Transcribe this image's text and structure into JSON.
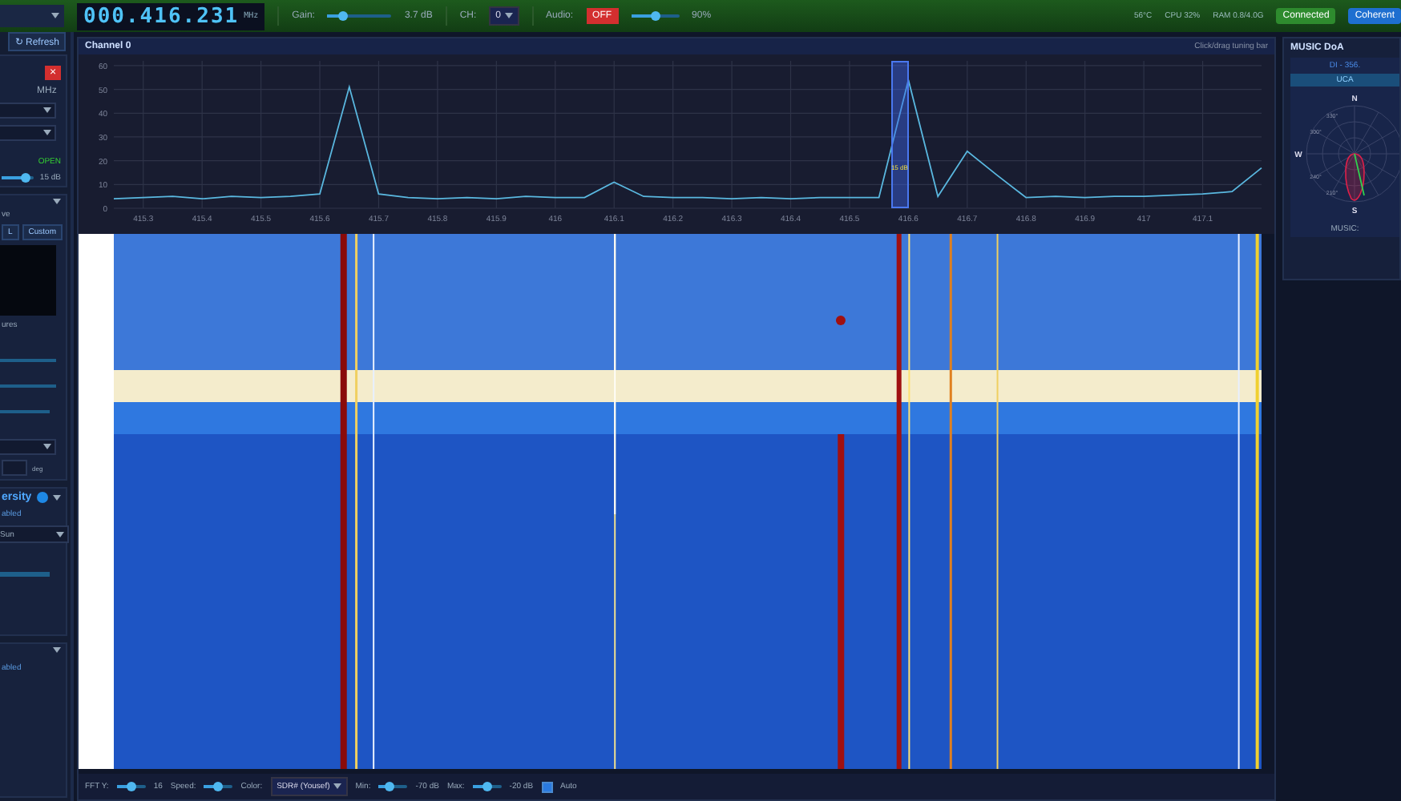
{
  "top_bar": {
    "freq": "000.416.231",
    "freq_unit": "MHz",
    "gain": {
      "label": "Gain:",
      "level": 0.25,
      "reading": "3.7 dB"
    },
    "channel": {
      "label": "CH:",
      "value": "0"
    },
    "audio": {
      "label": "Audio:",
      "button": "OFF",
      "level": 0.5,
      "reading": "90%"
    },
    "stats": [
      "56°C",
      "CPU 32%",
      "RAM 0.8/4.0G"
    ],
    "badges": [
      {
        "label": "Connected",
        "kind": "ok"
      },
      {
        "label": "Coherent",
        "kind": "info"
      }
    ]
  },
  "left_panel": {
    "refresh_button": "↻ Refresh",
    "close_button": "×",
    "unit": "MHz",
    "status": "OPEN",
    "squelch": {
      "level": 0.75,
      "reading": "15 dB"
    },
    "array_text": "ve",
    "array_buttons": [
      {
        "label": "L",
        "selected": false
      },
      {
        "label": "Custom",
        "selected": false
      }
    ],
    "array_caption": "ures",
    "angle_unit": "deg",
    "diversity": {
      "title": "ersity",
      "status": "abled",
      "select": "Sun"
    },
    "footer_status": "abled"
  },
  "channel": {
    "title": "Channel 0",
    "hint": "Click/drag tuning bar",
    "tuning_reading": "15 dB",
    "chart_data": {
      "type": "line",
      "grid": true,
      "xlim": [
        415.25,
        417.2
      ],
      "ylim": [
        0,
        62
      ],
      "x": [
        415.25,
        415.3,
        415.35,
        415.4,
        415.45,
        415.5,
        415.55,
        415.6,
        415.65,
        415.7,
        415.75,
        415.8,
        415.85,
        415.9,
        415.95,
        416.0,
        416.05,
        416.1,
        416.15,
        416.2,
        416.25,
        416.3,
        416.35,
        416.4,
        416.45,
        416.5,
        416.55,
        416.6,
        416.65,
        416.7,
        416.75,
        416.8,
        416.85,
        416.9,
        416.95,
        417.0,
        417.05,
        417.1,
        417.15,
        417.2
      ],
      "series": [
        {
          "color": "#5ab8e0",
          "values": [
            4,
            4.5,
            5,
            4,
            5,
            4.5,
            5,
            6,
            51,
            6,
            4.5,
            4,
            4.5,
            4,
            5,
            4.5,
            4.5,
            11,
            5,
            4.5,
            4.5,
            4,
            4.5,
            4,
            4.5,
            4.5,
            4.5,
            54,
            5,
            24,
            14,
            4.5,
            5,
            4.5,
            5,
            5,
            5.5,
            6,
            7,
            17
          ]
        }
      ],
      "xticks": [
        {
          "value": 415.3,
          "label": "415.3"
        },
        {
          "value": 415.4,
          "label": "415.4"
        },
        {
          "value": 415.5,
          "label": "415.5"
        },
        {
          "value": 415.6,
          "label": "415.6"
        },
        {
          "value": 415.7,
          "label": "415.7"
        },
        {
          "value": 415.8,
          "label": "415.8"
        },
        {
          "value": 415.9,
          "label": "415.9"
        },
        {
          "value": 416,
          "label": "416"
        },
        {
          "value": 416.1,
          "label": "416.1"
        },
        {
          "value": 416.2,
          "label": "416.2"
        },
        {
          "value": 416.3,
          "label": "416.3"
        },
        {
          "value": 416.4,
          "label": "416.4"
        },
        {
          "value": 416.5,
          "label": "416.5"
        },
        {
          "value": 416.6,
          "label": "416.6"
        },
        {
          "value": 416.7,
          "label": "416.7"
        },
        {
          "value": 416.8,
          "label": "416.8"
        },
        {
          "value": 416.9,
          "label": "416.9"
        },
        {
          "value": 417,
          "label": "417"
        },
        {
          "value": 417.1,
          "label": "417.1"
        }
      ],
      "yticks": [
        0,
        10,
        20,
        30,
        40,
        50,
        60
      ]
    }
  },
  "bottom_bar": {
    "controls": [
      {
        "kind": "slider",
        "label": "FFT Y:",
        "level": 0.5,
        "reading": "16"
      },
      {
        "kind": "slider",
        "label": "Speed:",
        "level": 0.5
      },
      {
        "kind": "select",
        "label": "Color:",
        "value": "SDR# (Yousef)"
      },
      {
        "kind": "slider",
        "label": "Min:",
        "level": 0.4,
        "reading": "-70 dB"
      },
      {
        "kind": "slider",
        "label": "Max:",
        "level": 0.5,
        "reading": "-20 dB"
      },
      {
        "kind": "checkbox",
        "label": "Auto",
        "checked": true
      }
    ]
  },
  "right_panel": {
    "title": "MUSIC DoA",
    "heading": "DI - 356.",
    "array": "UCA",
    "compass": [
      "N",
      "W",
      "S"
    ],
    "angles": [
      "330°",
      "300°",
      "240°",
      "210°"
    ],
    "result_label": "MUSIC:"
  }
}
